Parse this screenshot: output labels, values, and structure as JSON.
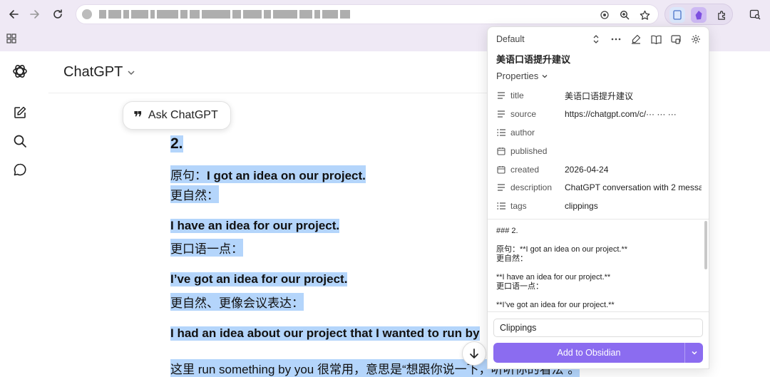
{
  "browser": {
    "omnibox_url_hidden": true,
    "extensions": [
      "page-icon",
      "obsidian-icon",
      "puzzle-icon"
    ],
    "accent": "#efe9f5"
  },
  "chatgpt": {
    "title": "ChatGPT",
    "ask_button": "Ask ChatGPT",
    "content": {
      "heading": "2.",
      "l1_prefix": "原句：",
      "l1_text": "I got an idea on our project.",
      "l2": "更自然：",
      "l3": "I have an idea for our project.",
      "l4": "更口语一点：",
      "l5": "I’ve got an idea for our project.",
      "l6": "更自然、更像会议表达：",
      "l7": "I had an idea about our project that I wanted to run by",
      "l8": "这里 run something by you 很常用，意思是“想跟你说一下，听听你的看法”。"
    }
  },
  "clipper": {
    "template": "Default",
    "title": "美语口语提升建议",
    "properties_label": "Properties",
    "properties": [
      {
        "icon": "text-icon",
        "name": "title",
        "value": "美语口语提升建议"
      },
      {
        "icon": "text-icon",
        "name": "source",
        "value": "https://chatgpt.com/c/··· ··· ···"
      },
      {
        "icon": "list-icon",
        "name": "author",
        "value": ""
      },
      {
        "icon": "calendar-icon",
        "name": "published",
        "value": ""
      },
      {
        "icon": "calendar-icon",
        "name": "created",
        "value": "2026-04-24"
      },
      {
        "icon": "text-icon",
        "name": "description",
        "value": "ChatGPT conversation with 2 messa"
      },
      {
        "icon": "list-icon",
        "name": "tags",
        "value": "clippings"
      }
    ],
    "note_lines": [
      "### 2.",
      "",
      "原句：**I got an idea on our project.**",
      "更自然：",
      "",
      "**I have an idea for our project.**",
      "更口语一点：",
      "",
      "**I’ve got an idea for our project.**"
    ],
    "folder": "Clippings",
    "add_button": "Add to Obsidian",
    "accent": "#8b6cf0"
  }
}
